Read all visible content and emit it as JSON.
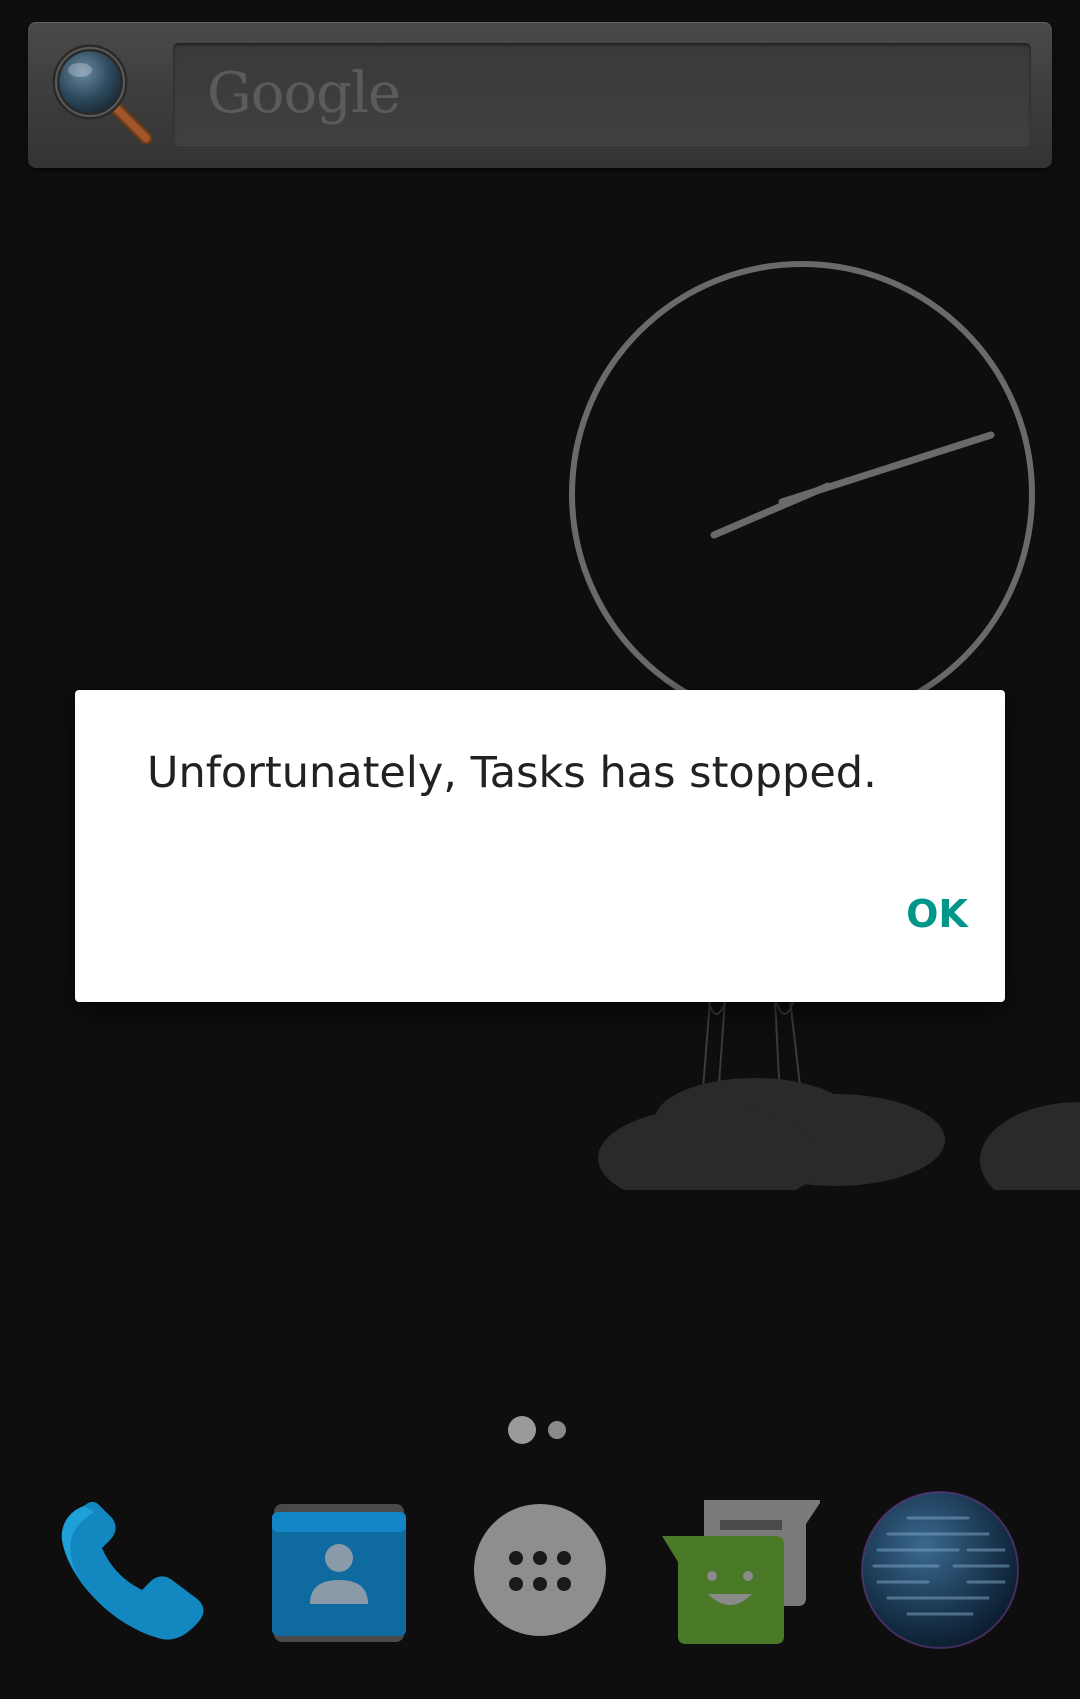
{
  "search_widget": {
    "placeholder": "Google",
    "icon": "search-icon"
  },
  "clock": {
    "type": "analog",
    "color": "#6a6a6a"
  },
  "page_indicator": {
    "pages": 2,
    "current": 1
  },
  "dock": {
    "items": [
      {
        "name": "phone",
        "icon": "phone-icon",
        "color": "#1aa0d8"
      },
      {
        "name": "contacts",
        "icon": "contacts-icon",
        "color": "#1b8fd0"
      },
      {
        "name": "all-apps",
        "icon": "apps-grid-icon",
        "color": "#9a9a9a"
      },
      {
        "name": "messaging",
        "icon": "messaging-icon",
        "color": "#6aaa3a"
      },
      {
        "name": "browser",
        "icon": "globe-icon",
        "color": "#2a6a9a"
      }
    ]
  },
  "dialog": {
    "message": "Unfortunately, Tasks has stopped.",
    "ok_label": "OK",
    "accent": "#009688"
  }
}
